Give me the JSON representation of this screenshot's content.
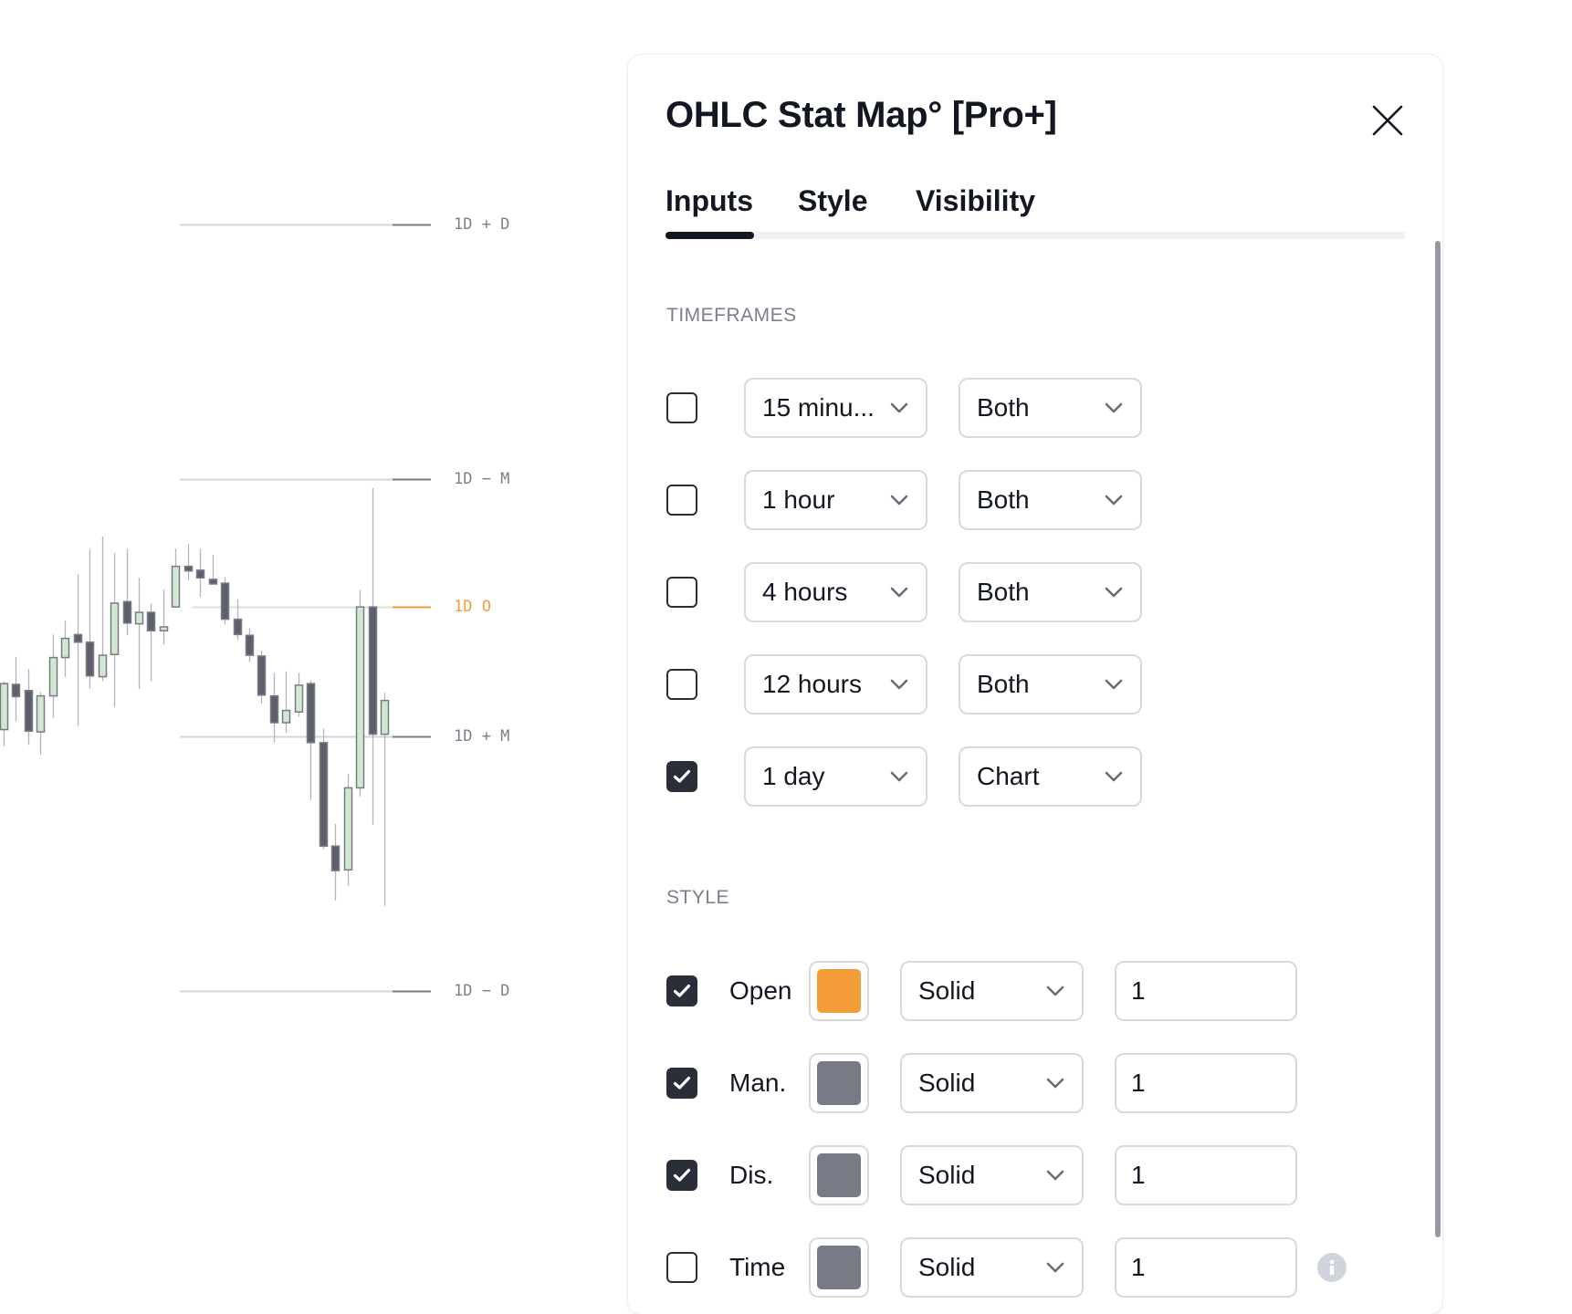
{
  "chart": {
    "price_levels": [
      {
        "label": "1D + D",
        "price": 100.0,
        "kind": "normal"
      },
      {
        "label": "1D − M",
        "price": 66.8,
        "kind": "normal"
      },
      {
        "label": "1D O",
        "price": 50.1,
        "kind": "open"
      },
      {
        "label": "1D + M",
        "price": 33.2,
        "kind": "normal"
      },
      {
        "label": "1D − D",
        "price": 0.0,
        "kind": "normal"
      }
    ],
    "colors": {
      "bull_fill": "#d1e8d0",
      "bear_fill": "#5d606b",
      "candle_border": "#787b86",
      "wick": "#b2b5be",
      "level_line": "#d1d4dc",
      "level_tick": "#787b86",
      "open_line": "#f39d38",
      "open_ref_line": "#d6e7d3"
    }
  },
  "chart_data": {
    "type": "candlestick",
    "title": "",
    "xlabel": "",
    "ylabel": "",
    "ylim": [
      -10,
      105
    ],
    "grid": false,
    "legend": "none",
    "annotations": [
      "1D + D",
      "1D − M",
      "1D O",
      "1D + M",
      "1D − D"
    ],
    "candles": [
      {
        "o": 34.1,
        "h": 40.4,
        "l": 31.9,
        "c": 40.1
      },
      {
        "o": 40.0,
        "h": 43.6,
        "l": 35.2,
        "c": 38.4
      },
      {
        "o": 39.2,
        "h": 42.0,
        "l": 32.1,
        "c": 33.9
      },
      {
        "o": 33.8,
        "h": 39.0,
        "l": 30.8,
        "c": 38.5
      },
      {
        "o": 38.5,
        "h": 46.5,
        "l": 35.6,
        "c": 43.5
      },
      {
        "o": 43.5,
        "h": 48.3,
        "l": 41.0,
        "c": 46.0
      },
      {
        "o": 46.5,
        "h": 54.4,
        "l": 34.6,
        "c": 45.5
      },
      {
        "o": 45.5,
        "h": 57.6,
        "l": 39.4,
        "c": 41.1
      },
      {
        "o": 41.0,
        "h": 59.3,
        "l": 40.4,
        "c": 43.8
      },
      {
        "o": 43.9,
        "h": 57.1,
        "l": 37.0,
        "c": 50.6
      },
      {
        "o": 50.8,
        "h": 57.7,
        "l": 46.4,
        "c": 48.0
      },
      {
        "o": 47.9,
        "h": 53.9,
        "l": 39.4,
        "c": 49.4
      },
      {
        "o": 49.4,
        "h": 50.5,
        "l": 40.4,
        "c": 47.0
      },
      {
        "o": 47.0,
        "h": 52.4,
        "l": 45.2,
        "c": 47.5
      },
      {
        "o": 50.1,
        "h": 57.7,
        "l": 50.1,
        "c": 55.4
      },
      {
        "o": 55.4,
        "h": 58.3,
        "l": 53.6,
        "c": 54.8
      },
      {
        "o": 54.9,
        "h": 57.7,
        "l": 51.4,
        "c": 53.9
      },
      {
        "o": 53.7,
        "h": 56.9,
        "l": 53.1,
        "c": 53.1
      },
      {
        "o": 53.2,
        "h": 54.0,
        "l": 47.8,
        "c": 48.5
      },
      {
        "o": 48.5,
        "h": 51.1,
        "l": 45.8,
        "c": 46.5
      },
      {
        "o": 46.4,
        "h": 47.3,
        "l": 42.9,
        "c": 43.8
      },
      {
        "o": 43.7,
        "h": 44.4,
        "l": 37.5,
        "c": 38.6
      },
      {
        "o": 38.5,
        "h": 41.5,
        "l": 32.4,
        "c": 35.0
      },
      {
        "o": 35.0,
        "h": 41.7,
        "l": 33.7,
        "c": 36.6
      },
      {
        "o": 36.4,
        "h": 41.5,
        "l": 35.8,
        "c": 39.9
      },
      {
        "o": 40.1,
        "h": 40.5,
        "l": 24.9,
        "c": 32.4
      },
      {
        "o": 32.4,
        "h": 34.2,
        "l": 18.5,
        "c": 18.9
      },
      {
        "o": 18.9,
        "h": 21.8,
        "l": 11.8,
        "c": 15.7
      },
      {
        "o": 15.8,
        "h": 28.3,
        "l": 13.7,
        "c": 26.5
      },
      {
        "o": 26.5,
        "h": 52.3,
        "l": 25.4,
        "c": 50.1
      },
      {
        "o": 50.1,
        "h": 65.6,
        "l": 21.7,
        "c": 33.5
      },
      {
        "o": 33.5,
        "h": 38.9,
        "l": 11.1,
        "c": 37.9
      }
    ]
  },
  "dialog": {
    "title": "OHLC Stat Map° [Pro+]",
    "close_icon": "close-icon",
    "tabs": [
      {
        "label": "Inputs",
        "active": true
      },
      {
        "label": "Style",
        "active": false
      },
      {
        "label": "Visibility",
        "active": false
      }
    ],
    "timeframes": {
      "section_title": "TIMEFRAMES",
      "rows": [
        {
          "checked": false,
          "timeframe": "15 minu...",
          "display": "Both"
        },
        {
          "checked": false,
          "timeframe": "1 hour",
          "display": "Both"
        },
        {
          "checked": false,
          "timeframe": "4 hours",
          "display": "Both"
        },
        {
          "checked": false,
          "timeframe": "12 hours",
          "display": "Both"
        },
        {
          "checked": true,
          "timeframe": "1 day",
          "display": "Chart"
        }
      ]
    },
    "style": {
      "section_title": "STYLE",
      "rows": [
        {
          "checked": true,
          "label": "Open",
          "color": "#f39d38",
          "line_style": "Solid",
          "width": "1",
          "info": false
        },
        {
          "checked": true,
          "label": "Man.",
          "color": "#787b86",
          "line_style": "Solid",
          "width": "1",
          "info": false
        },
        {
          "checked": true,
          "label": "Dis.",
          "color": "#787b86",
          "line_style": "Solid",
          "width": "1",
          "info": false
        },
        {
          "checked": false,
          "label": "Time",
          "color": "#787b86",
          "line_style": "Solid",
          "width": "1",
          "info": true
        }
      ]
    }
  }
}
